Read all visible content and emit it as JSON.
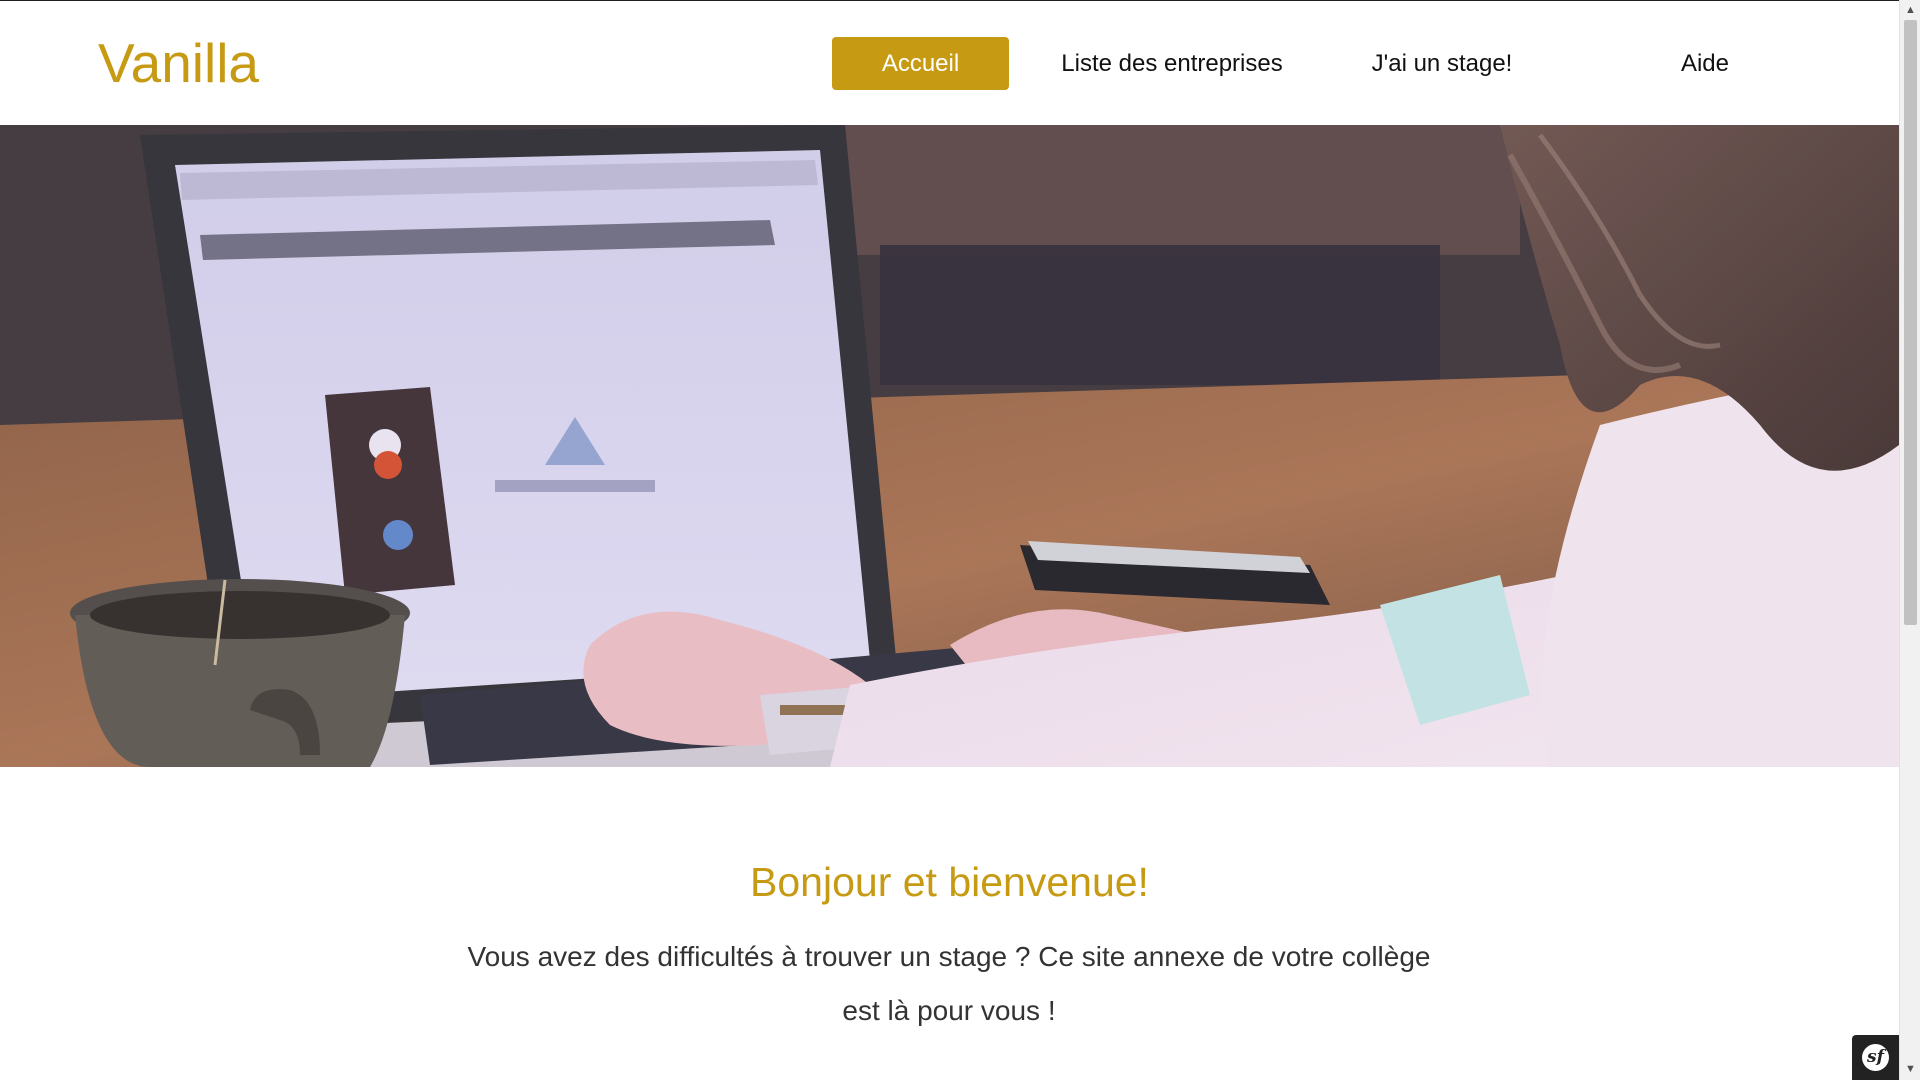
{
  "header": {
    "brand": "Vanilla",
    "nav": [
      {
        "label": "Accueil",
        "active": true
      },
      {
        "label": "Liste des entreprises",
        "active": false
      },
      {
        "label": "J'ai un stage!",
        "active": false
      },
      {
        "label": "Aide",
        "active": false
      }
    ]
  },
  "hero": {
    "image": "woman-typing-on-laptop-photo"
  },
  "welcome": {
    "title": "Bonjour et bienvenue!",
    "text": "Vous avez des difficultés à trouver un stage ? Ce site annexe de votre collège est là pour vous !"
  },
  "debug_toolbar": {
    "icon": "symfony-icon",
    "glyph": "sf"
  },
  "colors": {
    "accent": "#c79a13",
    "text": "#333333",
    "nav_text": "#111111"
  },
  "scrollbar": {
    "up_arrow": "▲",
    "down_arrow": "▼"
  }
}
